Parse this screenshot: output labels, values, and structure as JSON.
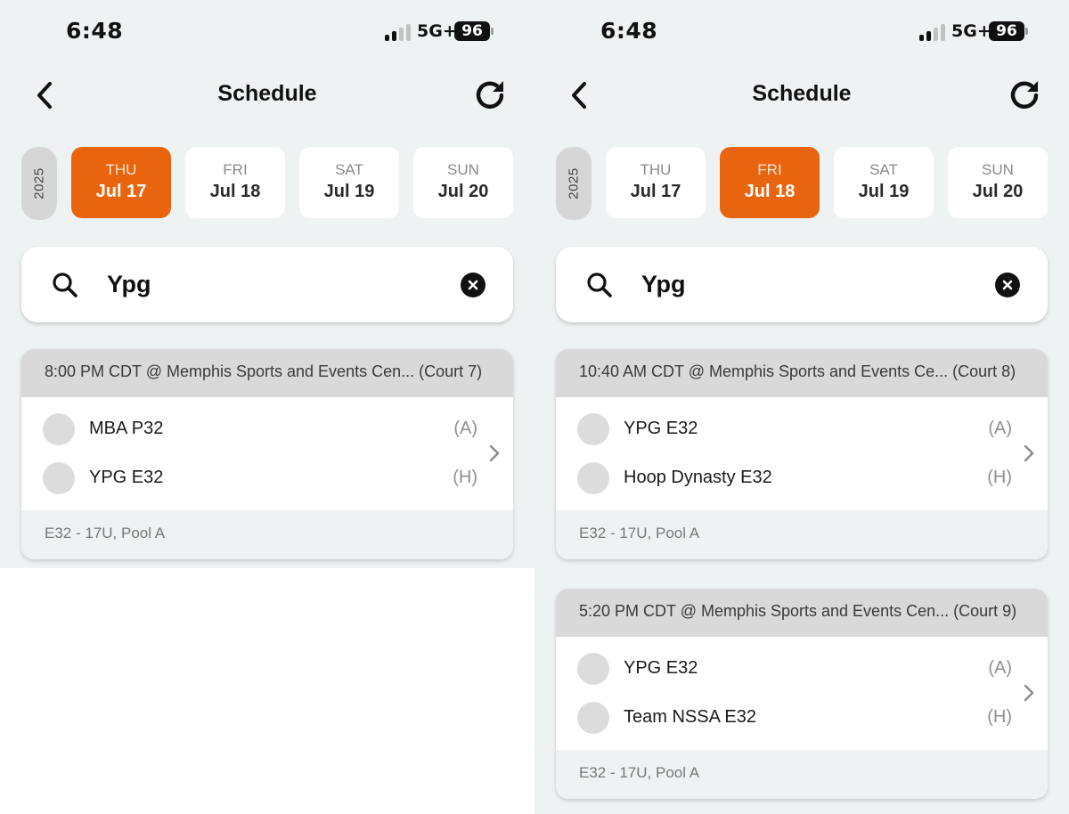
{
  "panels": [
    {
      "status": {
        "time": "6:48",
        "network": "5G+",
        "battery": "96"
      },
      "header": {
        "title": "Schedule"
      },
      "year": "2025",
      "dates": [
        {
          "dow": "THU",
          "day": "Jul 17",
          "active": true
        },
        {
          "dow": "FRI",
          "day": "Jul 18",
          "active": false
        },
        {
          "dow": "SAT",
          "day": "Jul 19",
          "active": false
        },
        {
          "dow": "SUN",
          "day": "Jul 20",
          "active": false
        }
      ],
      "search": {
        "value": "Ypg"
      },
      "games": [
        {
          "header": "8:00 PM CDT @ Memphis Sports and Events Cen... (Court 7)",
          "teams": [
            {
              "name": "MBA P32",
              "side": "(A)"
            },
            {
              "name": "YPG E32",
              "side": "(H)"
            }
          ],
          "footer": "E32 - 17U, Pool A"
        }
      ]
    },
    {
      "status": {
        "time": "6:48",
        "network": "5G+",
        "battery": "96"
      },
      "header": {
        "title": "Schedule"
      },
      "year": "2025",
      "dates": [
        {
          "dow": "THU",
          "day": "Jul 17",
          "active": false
        },
        {
          "dow": "FRI",
          "day": "Jul 18",
          "active": true
        },
        {
          "dow": "SAT",
          "day": "Jul 19",
          "active": false
        },
        {
          "dow": "SUN",
          "day": "Jul 20",
          "active": false
        }
      ],
      "search": {
        "value": "Ypg"
      },
      "games": [
        {
          "header": "10:40 AM CDT @ Memphis Sports and Events Ce... (Court 8)",
          "teams": [
            {
              "name": "YPG E32",
              "side": "(A)"
            },
            {
              "name": "Hoop Dynasty E32",
              "side": "(H)"
            }
          ],
          "footer": "E32 - 17U, Pool A"
        },
        {
          "header": "5:20 PM CDT @ Memphis Sports and Events Cen... (Court 9)",
          "teams": [
            {
              "name": "YPG E32",
              "side": "(A)"
            },
            {
              "name": "Team NSSA E32",
              "side": "(H)"
            }
          ],
          "footer": "E32 - 17U, Pool A"
        }
      ]
    }
  ],
  "colors": {
    "accent": "#e8640e",
    "background": "#eff2f3",
    "card_header": "#d9d9d9"
  },
  "icons": [
    "back-chevron-icon",
    "refresh-icon",
    "search-icon",
    "clear-icon",
    "chevron-right-icon",
    "signal-icon"
  ]
}
